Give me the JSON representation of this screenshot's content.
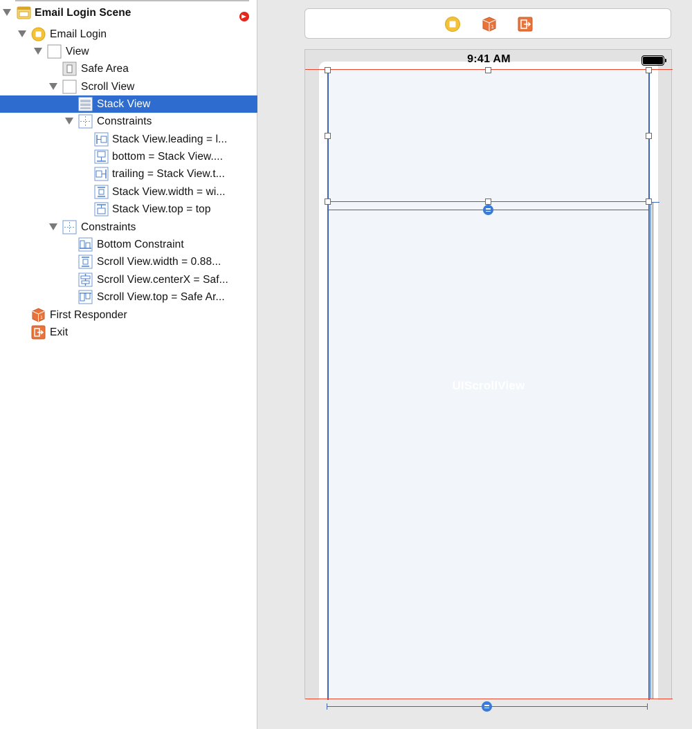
{
  "outline": {
    "items": [
      {
        "label": "Email Login Scene",
        "icon": "scene-icon",
        "disclosure": "expanded"
      },
      {
        "label": "Email Login",
        "icon": "view-controller-icon",
        "disclosure": "expanded"
      },
      {
        "label": "View",
        "icon": "view-icon",
        "disclosure": "expanded"
      },
      {
        "label": "Safe Area",
        "icon": "safe-area-icon",
        "disclosure": "none"
      },
      {
        "label": "Scroll View",
        "icon": "view-icon",
        "disclosure": "expanded"
      },
      {
        "label": "Stack View",
        "icon": "stack-view-icon",
        "disclosure": "none",
        "selected": true
      },
      {
        "label": "Constraints",
        "icon": "constraints-icon",
        "disclosure": "expanded"
      },
      {
        "label": "Stack View.leading = l...",
        "icon": "leading-constraint-icon",
        "disclosure": "none"
      },
      {
        "label": "bottom = Stack View....",
        "icon": "bottom-constraint-icon",
        "disclosure": "none"
      },
      {
        "label": "trailing = Stack View.t...",
        "icon": "trailing-constraint-icon",
        "disclosure": "none"
      },
      {
        "label": "Stack View.width = wi...",
        "icon": "width-constraint-icon",
        "disclosure": "none"
      },
      {
        "label": "Stack View.top = top",
        "icon": "top-constraint-icon",
        "disclosure": "none"
      },
      {
        "label": "Constraints",
        "icon": "constraints-icon",
        "disclosure": "expanded"
      },
      {
        "label": "Bottom Constraint",
        "icon": "bottom-align-constraint-icon",
        "disclosure": "none"
      },
      {
        "label": "Scroll View.width = 0.88...",
        "icon": "width-constraint-icon",
        "disclosure": "none"
      },
      {
        "label": "Scroll View.centerX = Saf...",
        "icon": "center-x-constraint-icon",
        "disclosure": "none"
      },
      {
        "label": "Scroll View.top = Safe Ar...",
        "icon": "top-align-constraint-icon",
        "disclosure": "none"
      },
      {
        "label": "First Responder",
        "icon": "first-responder-icon",
        "disclosure": "none"
      },
      {
        "label": "Exit",
        "icon": "exit-icon",
        "disclosure": "none"
      }
    ]
  },
  "canvas": {
    "dock_icons": [
      "view-controller-icon",
      "first-responder-icon",
      "exit-icon"
    ],
    "status_time": "9:41 AM",
    "scroll_view_label": "UIScrollView"
  },
  "colors": {
    "selection": "#2f6ccf",
    "constraint_blue": "#3f65b8",
    "safe_area_red": "#e8452c",
    "scene_yellow": "#f5c136",
    "responder_orange": "#e8743b"
  }
}
